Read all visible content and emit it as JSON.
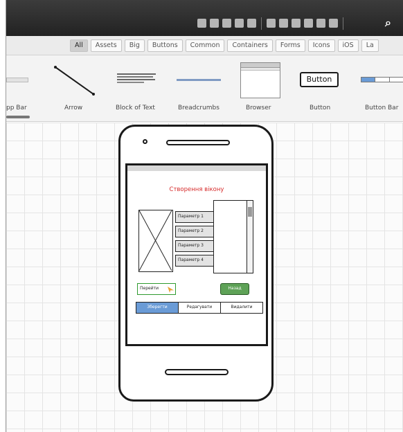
{
  "toolbar": {
    "icons": [
      "undo-icon",
      "redo-icon",
      "copy-icon",
      "paste-icon",
      "duplicate-icon",
      "group-icon",
      "ungroup-icon",
      "align-icon",
      "lock-icon",
      "delete-icon",
      "trash-icon",
      "search-icon"
    ]
  },
  "filter_tabs": [
    "All",
    "Assets",
    "Big",
    "Buttons",
    "Common",
    "Containers",
    "Forms",
    "Icons",
    "iOS",
    "La"
  ],
  "active_tab": "All",
  "gallery": {
    "items": [
      {
        "label": "pp Bar"
      },
      {
        "label": "Arrow"
      },
      {
        "label": "Block of Text"
      },
      {
        "label": "Breadcrumbs"
      },
      {
        "label": "Browser"
      },
      {
        "label": "Button",
        "preview_text": "Button"
      },
      {
        "label": "Button Bar"
      }
    ]
  },
  "mockup": {
    "title": "Створення вікону",
    "params": [
      "Параметр 1",
      "Параметр 2",
      "Параметр 3",
      "Параметр 4"
    ],
    "go_input": "Перейти",
    "next_button": "Назад",
    "segments": [
      "Зберегти",
      "Редагувати",
      "Видалити"
    ],
    "active_segment": "Зберегти"
  }
}
